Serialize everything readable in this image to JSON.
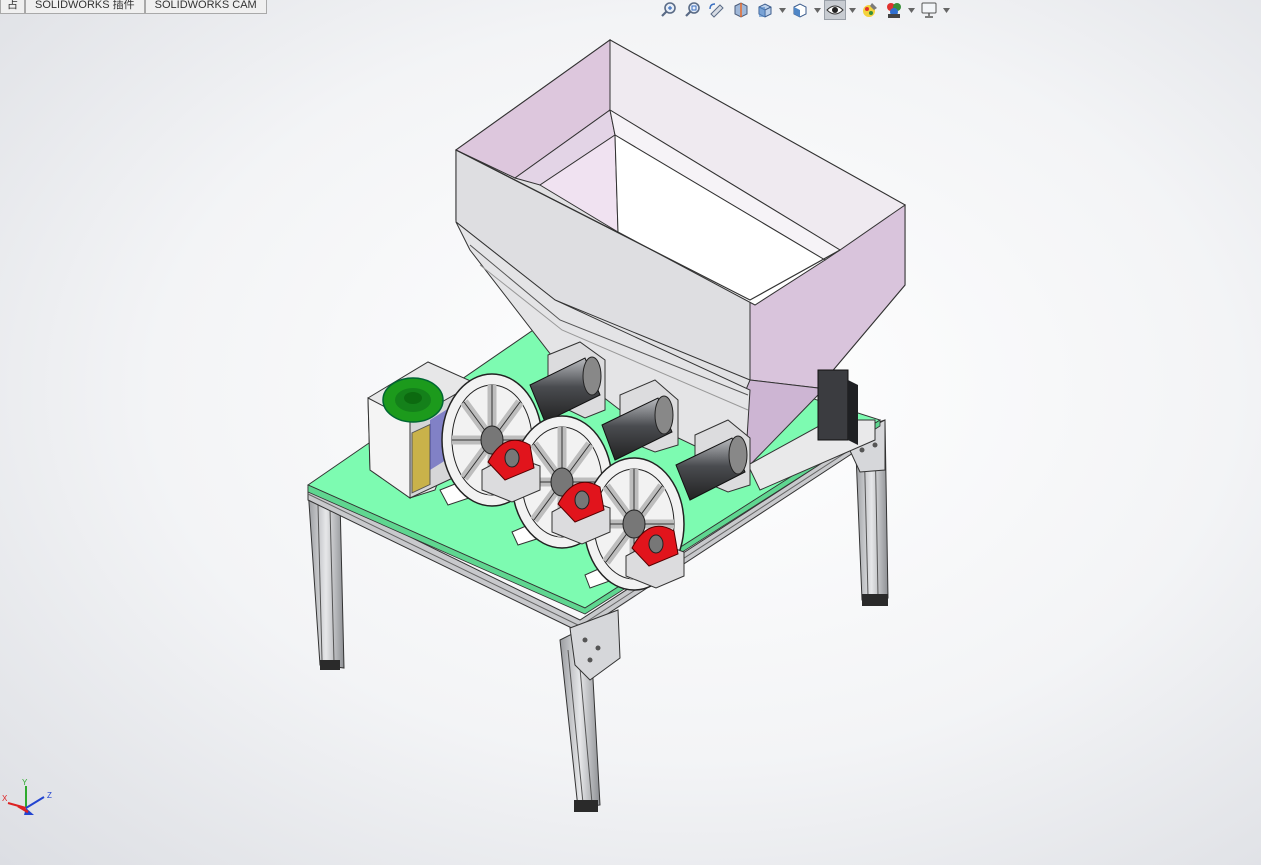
{
  "tabs": [
    {
      "label": "占"
    },
    {
      "label": "SOLIDWORKS 插件"
    },
    {
      "label": "SOLIDWORKS CAM"
    }
  ],
  "heads_up_toolbar": [
    {
      "icon": "zoom-to-fit-icon"
    },
    {
      "icon": "zoom-to-area-icon"
    },
    {
      "icon": "previous-view-icon"
    },
    {
      "icon": "section-view-icon"
    },
    {
      "icon": "view-orientation-icon",
      "dropdown": true
    },
    {
      "icon": "display-style-icon",
      "dropdown": true
    },
    {
      "icon": "hide-show-items-icon",
      "dropdown": true,
      "active": true
    },
    {
      "icon": "edit-appearance-icon"
    },
    {
      "icon": "apply-scene-icon",
      "dropdown": true
    },
    {
      "icon": "view-settings-icon",
      "dropdown": true
    }
  ],
  "triad": {
    "x": "X",
    "y": "Y",
    "z": "Z"
  },
  "colors": {
    "plate": "#7dfbb1",
    "hopper_outer": "#e1e1e3",
    "hopper_inner": "#ddc7dd",
    "bearing_red": "#e1141c",
    "motor_cover_green": "#149a14",
    "frame_silver": "#c8c9cc"
  }
}
